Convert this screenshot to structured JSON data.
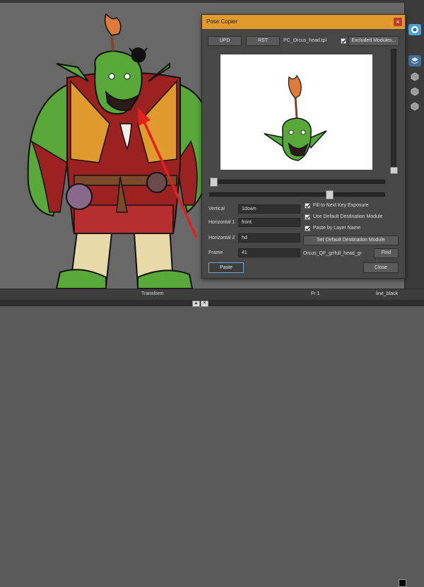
{
  "dialog": {
    "title": "Pose Copier",
    "close_glyph": "×",
    "upd_label": "UPD",
    "rst_label": "RST",
    "template_name": "PC_Orcus_head.tpl",
    "excluded_modules_checked": true,
    "excluded_modules_label": "Excluded Modules...",
    "fields": {
      "vertical_label": "Vertical",
      "vertical_value": "1down",
      "horizontal1_label": "Horizontal 1",
      "horizontal1_value": "front",
      "horizontal2_label": "Horizontal 2",
      "horizontal2_value": "hd",
      "frame_label": "Frame",
      "frame_value": "41"
    },
    "options": {
      "fill_next_key": "Fill to Next Key Exposure",
      "use_default_dest": "Use Default Destination Module",
      "paste_by_layer": "Paste by Layer Name"
    },
    "set_default_label": "Set Default Destination Module",
    "destination_path": "Orcus_QF_gr/full_head_gr",
    "find_label": "Find",
    "paste_label": "Paste",
    "close_label": "Close"
  },
  "status_bar": {
    "mode": "Transform",
    "frame": "Fr 1",
    "color_name": "line_black"
  },
  "colors": {
    "title_bar": "#e29a2b",
    "dialog_bg": "#474747",
    "canvas_bg": "#686868",
    "arrow": "#e3201b",
    "orc_skin": "#58a83a"
  },
  "icons": [
    "camera-view-icon",
    "layers-icon",
    "cube-icon",
    "cube-icon",
    "cube-icon"
  ]
}
